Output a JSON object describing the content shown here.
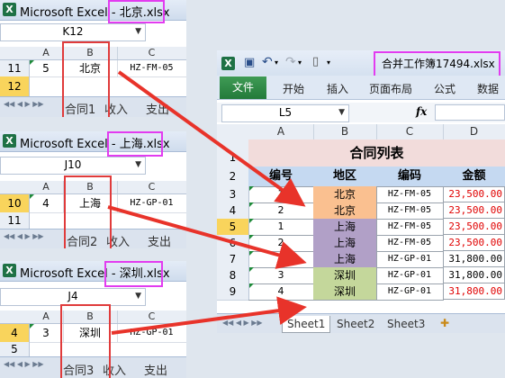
{
  "panes": [
    {
      "title_prefix": "Microsoft Excel - ",
      "file": "北京.xlsx",
      "namebox": "K12",
      "cols": [
        "A",
        "B",
        "C"
      ],
      "data_row": {
        "num": "11",
        "a": "5",
        "b": "北京",
        "c": "HZ-FM-05"
      },
      "sel_row": "12",
      "tabs": [
        "合同1",
        "收入",
        "支出"
      ]
    },
    {
      "title_prefix": "Microsoft Excel - ",
      "file": "上海.xlsx",
      "namebox": "J10",
      "cols": [
        "A",
        "B",
        "C"
      ],
      "data_row": {
        "num": "10",
        "a": "4",
        "b": "上海",
        "c": "HZ-GP-01"
      },
      "next_row": "11",
      "tabs": [
        "合同2",
        "收入",
        "支出"
      ]
    },
    {
      "title_prefix": "Microsoft Excel - ",
      "file": "深圳.xlsx",
      "namebox": "J4",
      "cols": [
        "A",
        "B",
        "C"
      ],
      "data_row": {
        "num": "4",
        "a": "3",
        "b": "深圳",
        "c": "HZ-GP-01"
      },
      "next_row": "5",
      "tabs": [
        "合同3",
        "收入",
        "支出"
      ]
    }
  ],
  "main": {
    "title": "合并工作簿17494.xlsx",
    "icon_letter": "X",
    "ribbon_tabs": [
      "文件",
      "开始",
      "插入",
      "页面布局",
      "公式",
      "数据"
    ],
    "namebox": "L5",
    "fx": "fx",
    "cols": [
      "A",
      "B",
      "C",
      "D"
    ],
    "table_title": "合同列表",
    "headers": [
      "编号",
      "地区",
      "编码",
      "金额"
    ],
    "rows": [
      {
        "num": "3",
        "id": "1",
        "region": "北京",
        "code": "HZ-FM-05",
        "amount": "23,500.00",
        "red": true
      },
      {
        "num": "4",
        "id": "2",
        "region": "北京",
        "code": "HZ-FM-05",
        "amount": "23,500.00",
        "red": true
      },
      {
        "num": "5",
        "id": "1",
        "region": "上海",
        "code": "HZ-FM-05",
        "amount": "23,500.00",
        "red": true
      },
      {
        "num": "6",
        "id": "2",
        "region": "上海",
        "code": "HZ-FM-05",
        "amount": "23,500.00",
        "red": true
      },
      {
        "num": "7",
        "id": "3",
        "region": "上海",
        "code": "HZ-GP-01",
        "amount": "31,800.00",
        "red": false
      },
      {
        "num": "8",
        "id": "3",
        "region": "深圳",
        "code": "HZ-GP-01",
        "amount": "31,800.00",
        "red": false
      },
      {
        "num": "9",
        "id": "4",
        "region": "深圳",
        "code": "HZ-GP-01",
        "amount": "31,800.00",
        "red": true
      }
    ],
    "row_labels": [
      "1",
      "2"
    ],
    "sheet_tabs": [
      "Sheet1",
      "Sheet2",
      "Sheet3"
    ]
  },
  "colors": {
    "beijing": "#fac090",
    "shanghai": "#b1a0c7",
    "shenzhen": "#c4d79b",
    "title_fill": "#f2dcdb",
    "header_fill": "#c5d9f1",
    "highlight_magenta": "#e23cf0",
    "highlight_red": "#e03b3b"
  }
}
